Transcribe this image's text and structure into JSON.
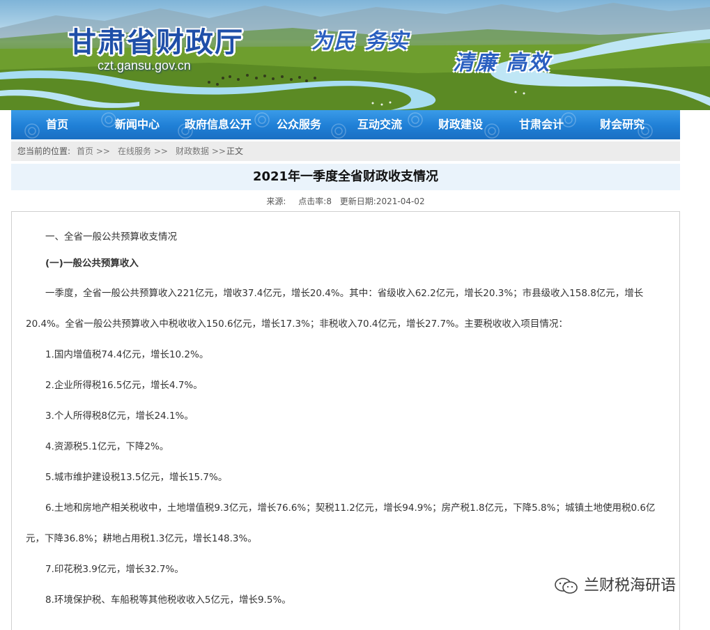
{
  "header": {
    "site_title": "甘肃省财政厅",
    "site_url": "czt.gansu.gov.cn",
    "slogan_1": "为民 务实",
    "slogan_2": "清廉 高效"
  },
  "nav": {
    "items": [
      "首页",
      "新闻中心",
      "政府信息公开",
      "公众服务",
      "互动交流",
      "财政建设",
      "甘肃会计",
      "财会研究"
    ]
  },
  "breadcrumb": {
    "prefix": "您当前的位置:",
    "items": [
      "首页 >>",
      "在线服务 >>",
      "财政数据 >>"
    ],
    "current": "正文"
  },
  "article": {
    "title": "2021年一季度全省财政收支情况",
    "source": "来源:",
    "clicks": "点击率:8",
    "date": "更新日期:2021-04-02",
    "paragraphs": [
      "一、全省一般公共预算收支情况",
      "(一)一般公共预算收入",
      "一季度，全省一般公共预算收入221亿元，增收37.4亿元，增长20.4%。其中：省级收入62.2亿元，增长20.3%；市县级收入158.8亿元，增长",
      "20.4%。全省一般公共预算收入中税收收入150.6亿元，增长17.3%；非税收入70.4亿元，增长27.7%。主要税收收入项目情况：",
      "1.国内增值税74.4亿元，增长10.2%。",
      "2.企业所得税16.5亿元，增长4.7%。",
      "3.个人所得税8亿元，增长24.1%。",
      "4.资源税5.1亿元，下降2%。",
      "5.城市维护建设税13.5亿元，增长15.7%。",
      "6.土地和房地产相关税收中，土地增值税9.3亿元，增长76.6%；契税11.2亿元，增长94.9%；房产税1.8亿元，下降5.8%；城镇土地使用税0.6亿",
      "元，下降36.8%；耕地占用税1.3亿元，增长148.3%。",
      "7.印花税3.9亿元，增长32.7%。",
      "8.环境保护税、车船税等其他税收收入5亿元，增长9.5%。"
    ]
  },
  "watermark": {
    "text": "兰财税海研语",
    "icon": "wechat-icon"
  },
  "colors": {
    "nav_blue": "#1f7fd6",
    "title_blue": "#1f4fa8",
    "title_bar_bg": "#eaf3fb",
    "crumb_bg": "#ececec"
  }
}
